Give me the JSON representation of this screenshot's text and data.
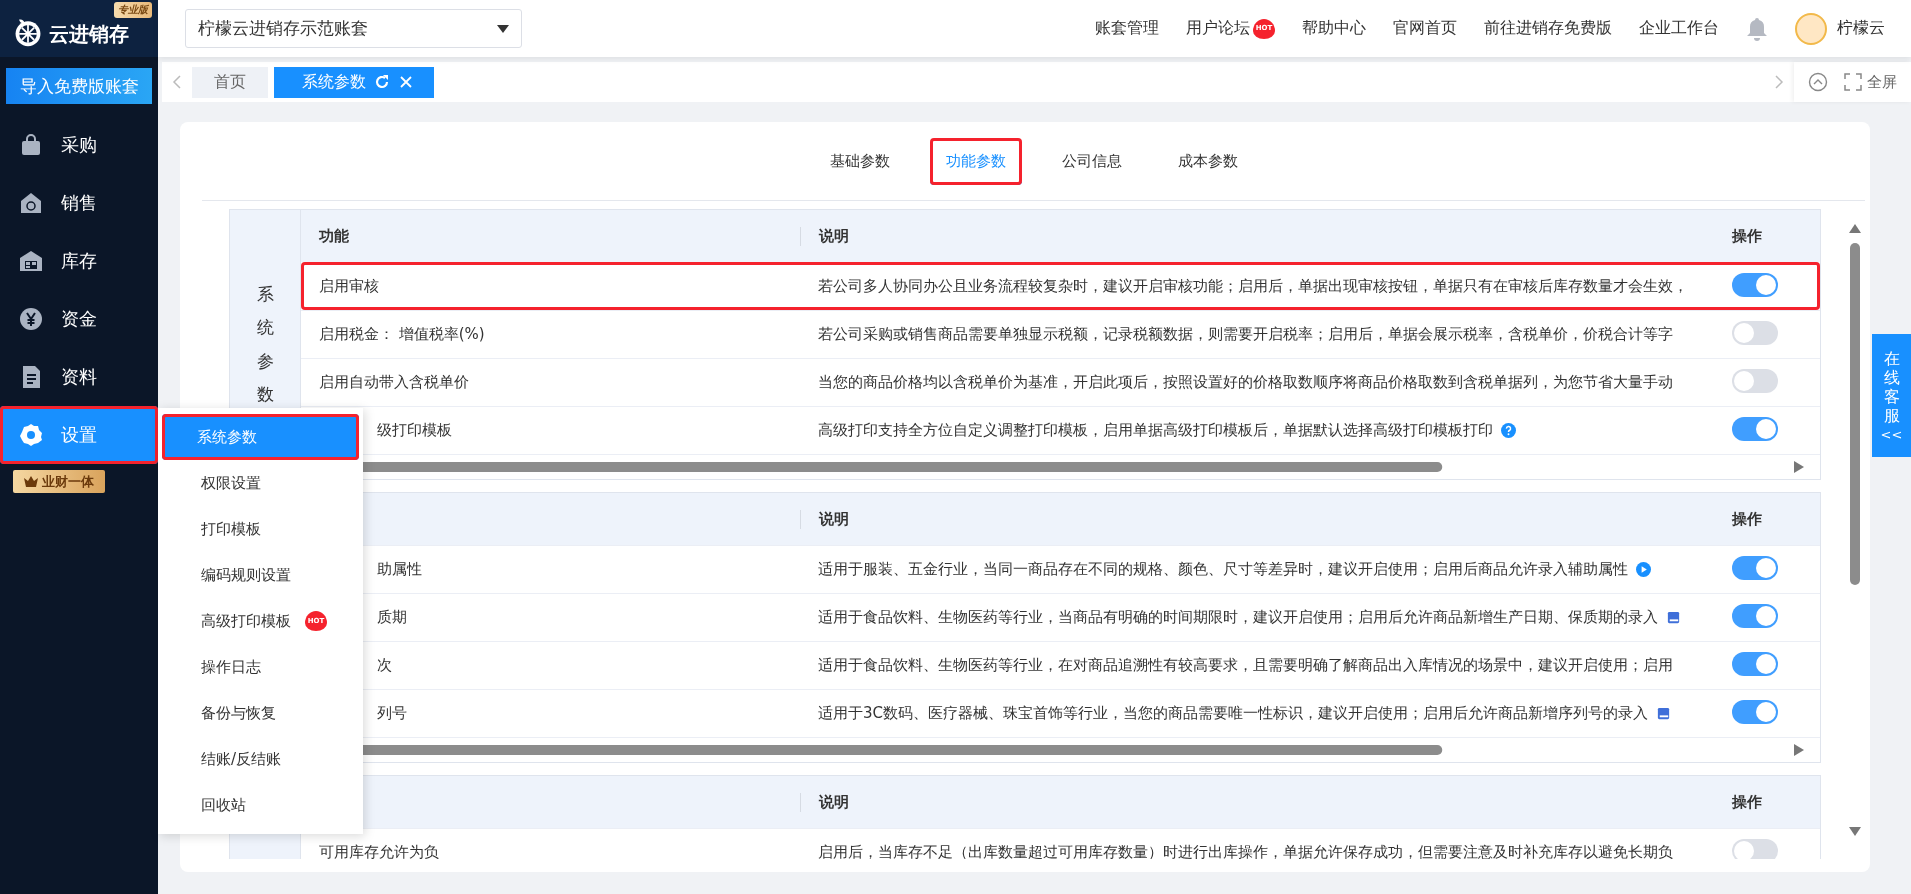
{
  "app": {
    "logo": "云进销存",
    "edition": "专业版",
    "import_button": "导入免费版账套"
  },
  "sidebar": {
    "items": [
      {
        "label": "采购",
        "selected": false,
        "annotated": false
      },
      {
        "label": "销售",
        "selected": false,
        "annotated": false
      },
      {
        "label": "库存",
        "selected": false,
        "annotated": false
      },
      {
        "label": "资金",
        "selected": false,
        "annotated": false
      },
      {
        "label": "资料",
        "selected": false,
        "annotated": false
      },
      {
        "label": "设置",
        "selected": true,
        "annotated": true
      }
    ],
    "badge": "业财一体"
  },
  "account_select": {
    "value": "柠檬云进销存示范账套"
  },
  "top_nav": [
    {
      "label": "账套管理"
    },
    {
      "label": "用户论坛",
      "badge": "HOT"
    },
    {
      "label": "帮助中心"
    },
    {
      "label": "官网首页"
    },
    {
      "label": "前往进销存免费版"
    },
    {
      "label": "企业工作台"
    }
  ],
  "user": {
    "name": "柠檬云"
  },
  "page_tabs": [
    {
      "label": "首页",
      "selected": false
    },
    {
      "label": "系统参数",
      "selected": true
    }
  ],
  "fullscreen": "全屏",
  "settings_tabs": [
    {
      "label": "基础参数",
      "selected": false,
      "annotated": false
    },
    {
      "label": "功能参数",
      "selected": true,
      "annotated": true
    },
    {
      "label": "公司信息",
      "selected": false,
      "annotated": false
    },
    {
      "label": "成本参数",
      "selected": false,
      "annotated": false
    }
  ],
  "tables": [
    {
      "section": "系统参数",
      "columns": {
        "feature": "功能",
        "description": "说明",
        "action": "操作"
      },
      "rows": [
        {
          "feature": "启用审核",
          "description": "若公司多人协同办公且业务流程较复杂时，建议开启审核功能；启用后，单据出现审核按钮，单据只有在审核后库存数量才会生效，",
          "on": true,
          "annotated": true,
          "covered": false
        },
        {
          "feature": "启用税金： 增值税率(%)",
          "description": "若公司采购或销售商品需要单独显示税额，记录税额数据，则需要开启税率；启用后，单据会展示税率，含税单价，价税合计等字",
          "on": false,
          "annotated": false,
          "covered": false
        },
        {
          "feature": "启用自动带入含税单价",
          "description": "当您的商品价格均以含税单价为基准，开启此项后，按照设置好的价格取数顺序将商品价格取数到含税单据列，为您节省大量手动",
          "on": false,
          "annotated": false,
          "covered": false
        },
        {
          "feature": "级打印模板",
          "description": "高级打印支持全方位自定义调整打印模板，启用单据高级打印模板后，单据默认选择高级打印模板打印",
          "kind": "help",
          "on": true,
          "annotated": false,
          "covered": true
        }
      ]
    },
    {
      "columns": {
        "description": "说明",
        "action": "操作"
      },
      "rows": [
        {
          "feature": "助属性",
          "description": "适用于服装、五金行业，当同一商品存在不同的规格、颜色、尺寸等差异时，建议开启使用；启用后商品允许录入辅助属性",
          "kind": "video",
          "on": true,
          "annotated": false,
          "covered": true
        },
        {
          "feature": "质期",
          "description": "适用于食品饮料、生物医药等行业，当商品有明确的时间期限时，建议开启使用；启用后允许商品新增生产日期、保质期的录入",
          "kind": "manual",
          "on": true,
          "annotated": false,
          "covered": true
        },
        {
          "feature": "次",
          "description": "适用于食品饮料、生物医药等行业，在对商品追溯性有较高要求，且需要明确了解商品出入库情况的场景中，建议开启使用；启用",
          "on": true,
          "annotated": false,
          "covered": true
        },
        {
          "feature": "列号",
          "description": "适用于3C数码、医疗器械、珠宝首饰等行业，当您的商品需要唯一性标识，建议开启使用；启用后允许商品新增序列号的录入",
          "kind": "manual",
          "on": true,
          "annotated": false,
          "covered": true
        }
      ]
    },
    {
      "columns": {
        "description": "说明",
        "action": "操作"
      },
      "rows": [
        {
          "feature": "可用库存允许为负",
          "description": "启用后，当库存不足（出库数量超过可用库存数量）时进行出库操作，单据允许保存成功，但需要注意及时补充库存以避免长期负",
          "on": false,
          "annotated": false,
          "covered": false
        }
      ]
    }
  ],
  "submenu": {
    "items": [
      {
        "label": "系统参数",
        "selected": true,
        "annotated": true
      },
      {
        "label": "权限设置",
        "selected": false,
        "annotated": false
      },
      {
        "label": "打印模板",
        "selected": false,
        "annotated": false
      },
      {
        "label": "编码规则设置",
        "selected": false,
        "annotated": false
      },
      {
        "label": "高级打印模板",
        "selected": false,
        "annotated": false,
        "badge": "HOT"
      },
      {
        "label": "操作日志",
        "selected": false,
        "annotated": false
      },
      {
        "label": "备份与恢复",
        "selected": false,
        "annotated": false
      },
      {
        "label": "结账/反结账",
        "selected": false,
        "annotated": false
      },
      {
        "label": "回收站",
        "selected": false,
        "annotated": false
      }
    ]
  },
  "support_tab": {
    "label": "在线客服",
    "arrow": "<<"
  }
}
